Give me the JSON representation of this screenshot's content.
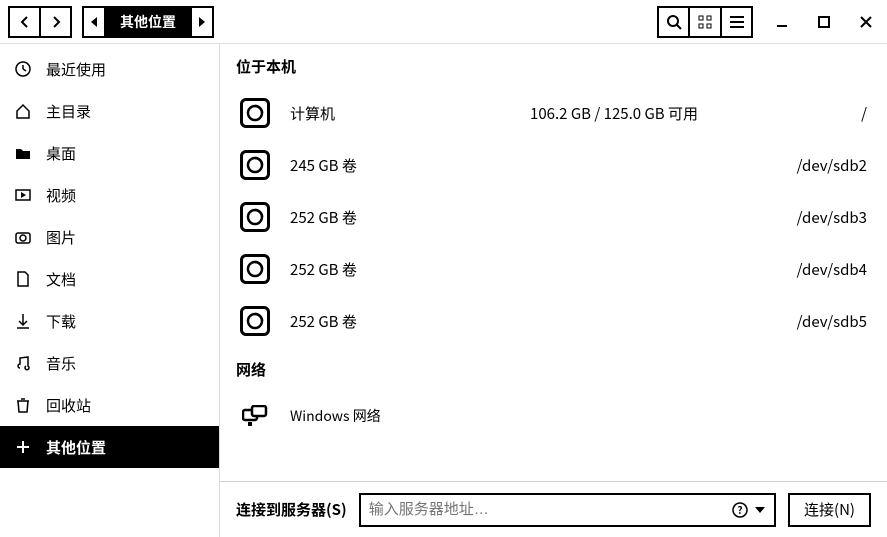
{
  "toolbar": {
    "path_current": "其他位置"
  },
  "sidebar": {
    "items": [
      {
        "label": "最近使用",
        "icon": "clock-icon",
        "active": false
      },
      {
        "label": "主目录",
        "icon": "home-icon",
        "active": false
      },
      {
        "label": "桌面",
        "icon": "folder-icon",
        "active": false
      },
      {
        "label": "视频",
        "icon": "video-icon",
        "active": false
      },
      {
        "label": "图片",
        "icon": "camera-icon",
        "active": false
      },
      {
        "label": "文档",
        "icon": "document-icon",
        "active": false
      },
      {
        "label": "下载",
        "icon": "download-icon",
        "active": false
      },
      {
        "label": "音乐",
        "icon": "music-icon",
        "active": false
      },
      {
        "label": "回收站",
        "icon": "trash-icon",
        "active": false
      },
      {
        "label": "其他位置",
        "icon": "plus-icon",
        "active": true
      }
    ]
  },
  "main": {
    "local_title": "位于本机",
    "drives": [
      {
        "name": "计算机",
        "info": "106.2 GB / 125.0 GB 可用",
        "path": "/"
      },
      {
        "name": "245 GB 卷",
        "info": "",
        "path": "/dev/sdb2"
      },
      {
        "name": "252 GB 卷",
        "info": "",
        "path": "/dev/sdb3"
      },
      {
        "name": "252 GB 卷",
        "info": "",
        "path": "/dev/sdb4"
      },
      {
        "name": "252 GB 卷",
        "info": "",
        "path": "/dev/sdb5"
      }
    ],
    "network_title": "网络",
    "networks": [
      {
        "name": "Windows 网络"
      }
    ]
  },
  "connect": {
    "label": "连接到服务器(S)",
    "placeholder": "输入服务器地址…",
    "button": "连接(N)"
  }
}
